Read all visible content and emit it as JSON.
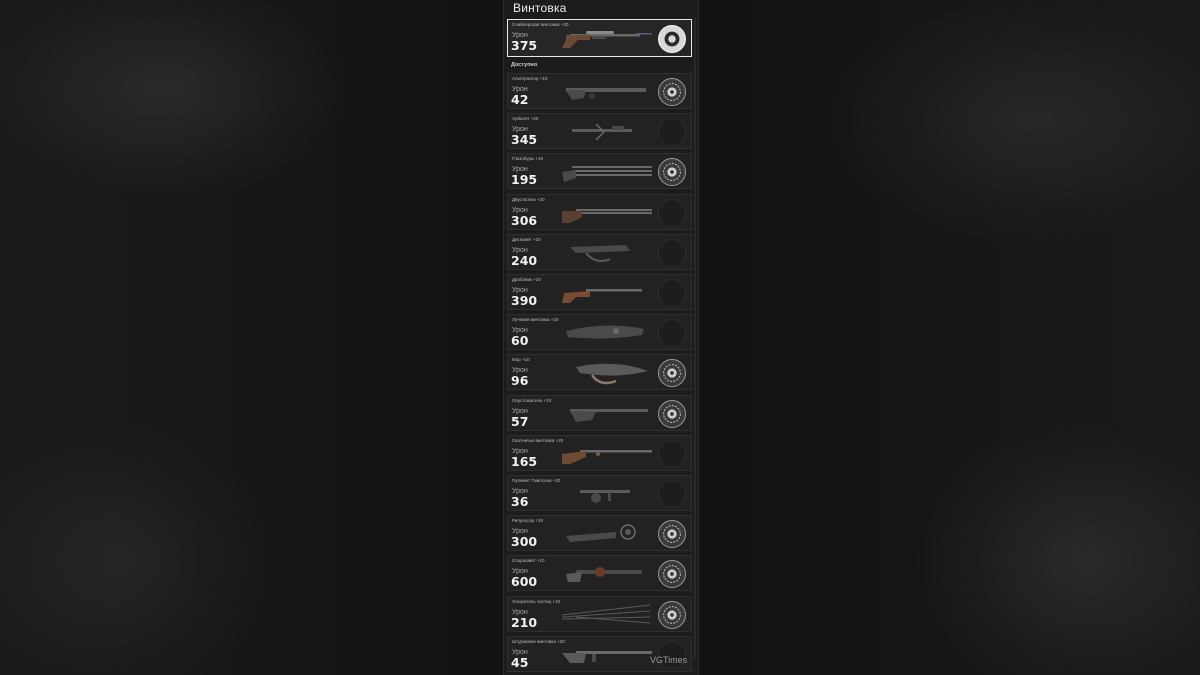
{
  "title": "Винтовка",
  "section_available": "Доступно",
  "damage_label": "Урон",
  "watermark": "VGTimes",
  "selected": {
    "name": "Снайперская винтовка +20",
    "damage": "375",
    "perk": "bright"
  },
  "items": [
    {
      "name": "Альтернатор +10",
      "damage": "42",
      "perk": "filled"
    },
    {
      "name": "Арбалет +20",
      "damage": "345",
      "perk": "empty"
    },
    {
      "name": "Глазобуры +10",
      "damage": "195",
      "perk": "filled"
    },
    {
      "name": "Двустволка +20",
      "damage": "306",
      "perk": "empty"
    },
    {
      "name": "Дискомет +20",
      "damage": "240",
      "perk": "empty"
    },
    {
      "name": "Дробовик +20",
      "damage": "390",
      "perk": "empty"
    },
    {
      "name": "Лучевая винтовка +20",
      "damage": "60",
      "perk": "empty"
    },
    {
      "name": "Мор +10",
      "damage": "96",
      "perk": "filled"
    },
    {
      "name": "Опустошитель +10",
      "damage": "57",
      "perk": "filled"
    },
    {
      "name": "Охотничья винтовка +20",
      "damage": "165",
      "perk": "empty"
    },
    {
      "name": "Пулемет Томпсона +20",
      "damage": "36",
      "perk": "empty"
    },
    {
      "name": "Репульсор +10",
      "damage": "300",
      "perk": "filled"
    },
    {
      "name": "Спорошвет +10",
      "damage": "600",
      "perk": "filled"
    },
    {
      "name": "Ускоритель частиц +10",
      "damage": "210",
      "perk": "filled"
    },
    {
      "name": "Штурмовая винтовка +20",
      "damage": "45",
      "perk": "empty"
    }
  ]
}
